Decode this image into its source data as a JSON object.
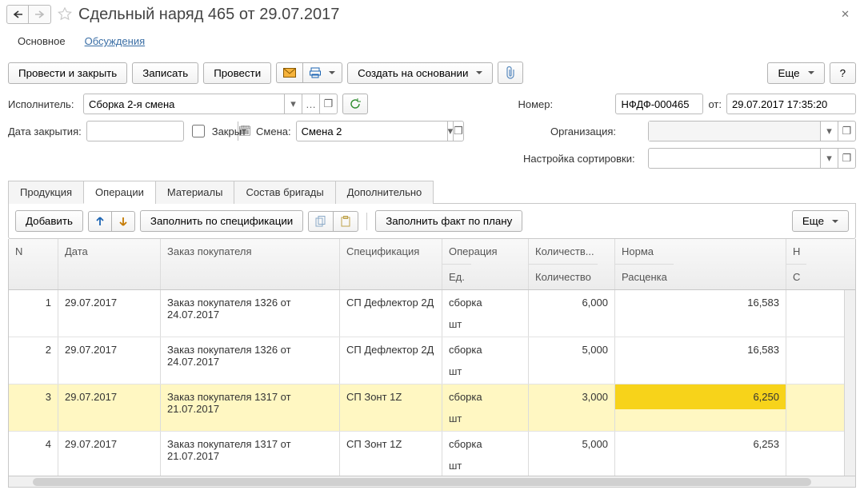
{
  "titlebar": {
    "title": "Сдельный наряд 465 от 29.07.2017"
  },
  "viewTabs": {
    "main": "Основное",
    "discuss": "Обсуждения"
  },
  "toolbar": {
    "postClose": "Провести и закрыть",
    "save": "Записать",
    "post": "Провести",
    "createBased": "Создать на основании",
    "more": "Еще",
    "help": "?"
  },
  "fields": {
    "performerLabel": "Исполнитель:",
    "performerValue": "Сборка 2-я смена",
    "closeDateLabel": "Дата закрытия:",
    "closeDateValue": "",
    "closedLabel": "Закрыт",
    "shiftFieldLabel": "Смена:",
    "shiftValue": "Смена 2",
    "numberLabel": "Номер:",
    "numberValue": "НФДФ-000465",
    "fromLabel": "от:",
    "dateValue": "29.07.2017 17:35:20",
    "orgLabel": "Организация:",
    "orgValue": "",
    "sortLabel": "Настройка сортировки:",
    "sortValue": ""
  },
  "tabs": {
    "products": "Продукция",
    "operations": "Операции",
    "materials": "Материалы",
    "crew": "Состав бригады",
    "extra": "Дополнительно"
  },
  "ops": {
    "add": "Добавить",
    "fillSpec": "Заполнить по спецификации",
    "fillFact": "Заполнить факт по плану",
    "more": "Еще"
  },
  "grid": {
    "headers": {
      "n": "N",
      "date": "Дата",
      "order": "Заказ покупателя",
      "spec": "Спецификация",
      "op": "Операция",
      "opSub": "Ед.",
      "qty": "Количеств...",
      "qtySub": "Количество",
      "norm": "Норма",
      "normSub": "Расценка",
      "last": "Н",
      "lastSub": "С"
    },
    "rows": [
      {
        "n": "1",
        "date": "29.07.2017",
        "order": "Заказ покупателя 1326  от 24.07.2017",
        "spec": "СП Дефлектор 2Д",
        "op": "сборка",
        "opSub": "шт",
        "qty": "6,000",
        "norm": "16,583"
      },
      {
        "n": "2",
        "date": "29.07.2017",
        "order": "Заказ покупателя 1326  от 24.07.2017",
        "spec": "СП Дефлектор 2Д",
        "op": "сборка",
        "opSub": "шт",
        "qty": "5,000",
        "norm": "16,583"
      },
      {
        "n": "3",
        "date": "29.07.2017",
        "order": "Заказ покупателя 1317  от 21.07.2017",
        "spec": "СП Зонт 1Z",
        "op": "сборка",
        "opSub": "шт",
        "qty": "3,000",
        "norm": "6,250",
        "selected": true
      },
      {
        "n": "4",
        "date": "29.07.2017",
        "order": "Заказ покупателя 1317  от 21.07.2017",
        "spec": "СП Зонт 1Z",
        "op": "сборка",
        "opSub": "шт",
        "qty": "5,000",
        "norm": "6,253"
      }
    ]
  }
}
